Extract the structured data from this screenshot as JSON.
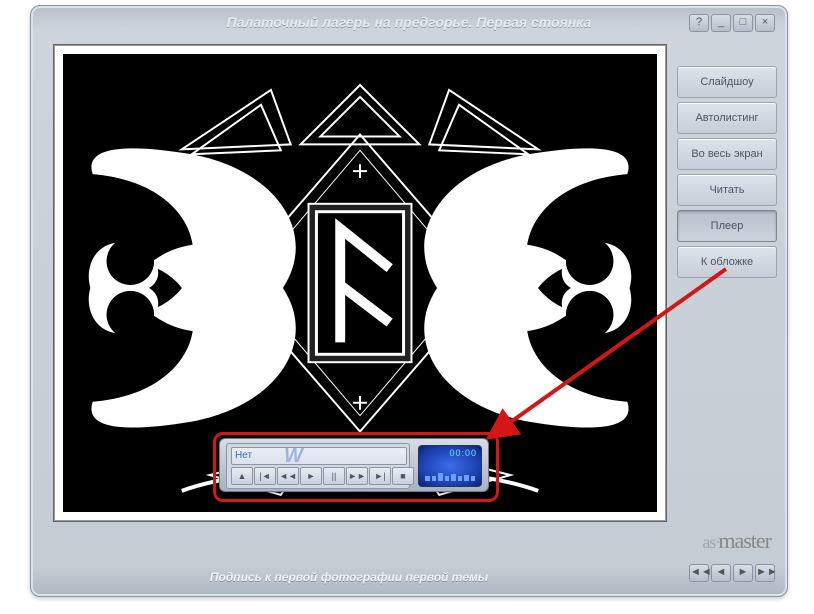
{
  "header": {
    "title": "Палаточный лагерь на предгорье. Первая стоянка"
  },
  "window_controls": {
    "help": "?",
    "min": "_",
    "max": "□",
    "close": "×"
  },
  "sidebar": {
    "items": [
      {
        "label": "Слайдшоу"
      },
      {
        "label": "Автолистинг"
      },
      {
        "label": "Во весь экран"
      },
      {
        "label": "Читать"
      },
      {
        "label": "Плеер"
      },
      {
        "label": "К обложке"
      }
    ]
  },
  "caption": "Подпись к первой фотографии первой темы",
  "logo": {
    "brand_left": "as",
    "brand_right": "master"
  },
  "player": {
    "track_text": "Нет",
    "watermark": "W",
    "time": "00:00",
    "controls": {
      "eject": "▲",
      "prev": "|◄",
      "rew": "◄◄",
      "play": "►",
      "pause": "||",
      "fwd": "►►",
      "next": "►|",
      "stop": "■"
    }
  },
  "nav": {
    "first": "◄◄",
    "prev": "◄",
    "next": "►",
    "last": "►►"
  },
  "colors": {
    "annot": "#d51616"
  }
}
